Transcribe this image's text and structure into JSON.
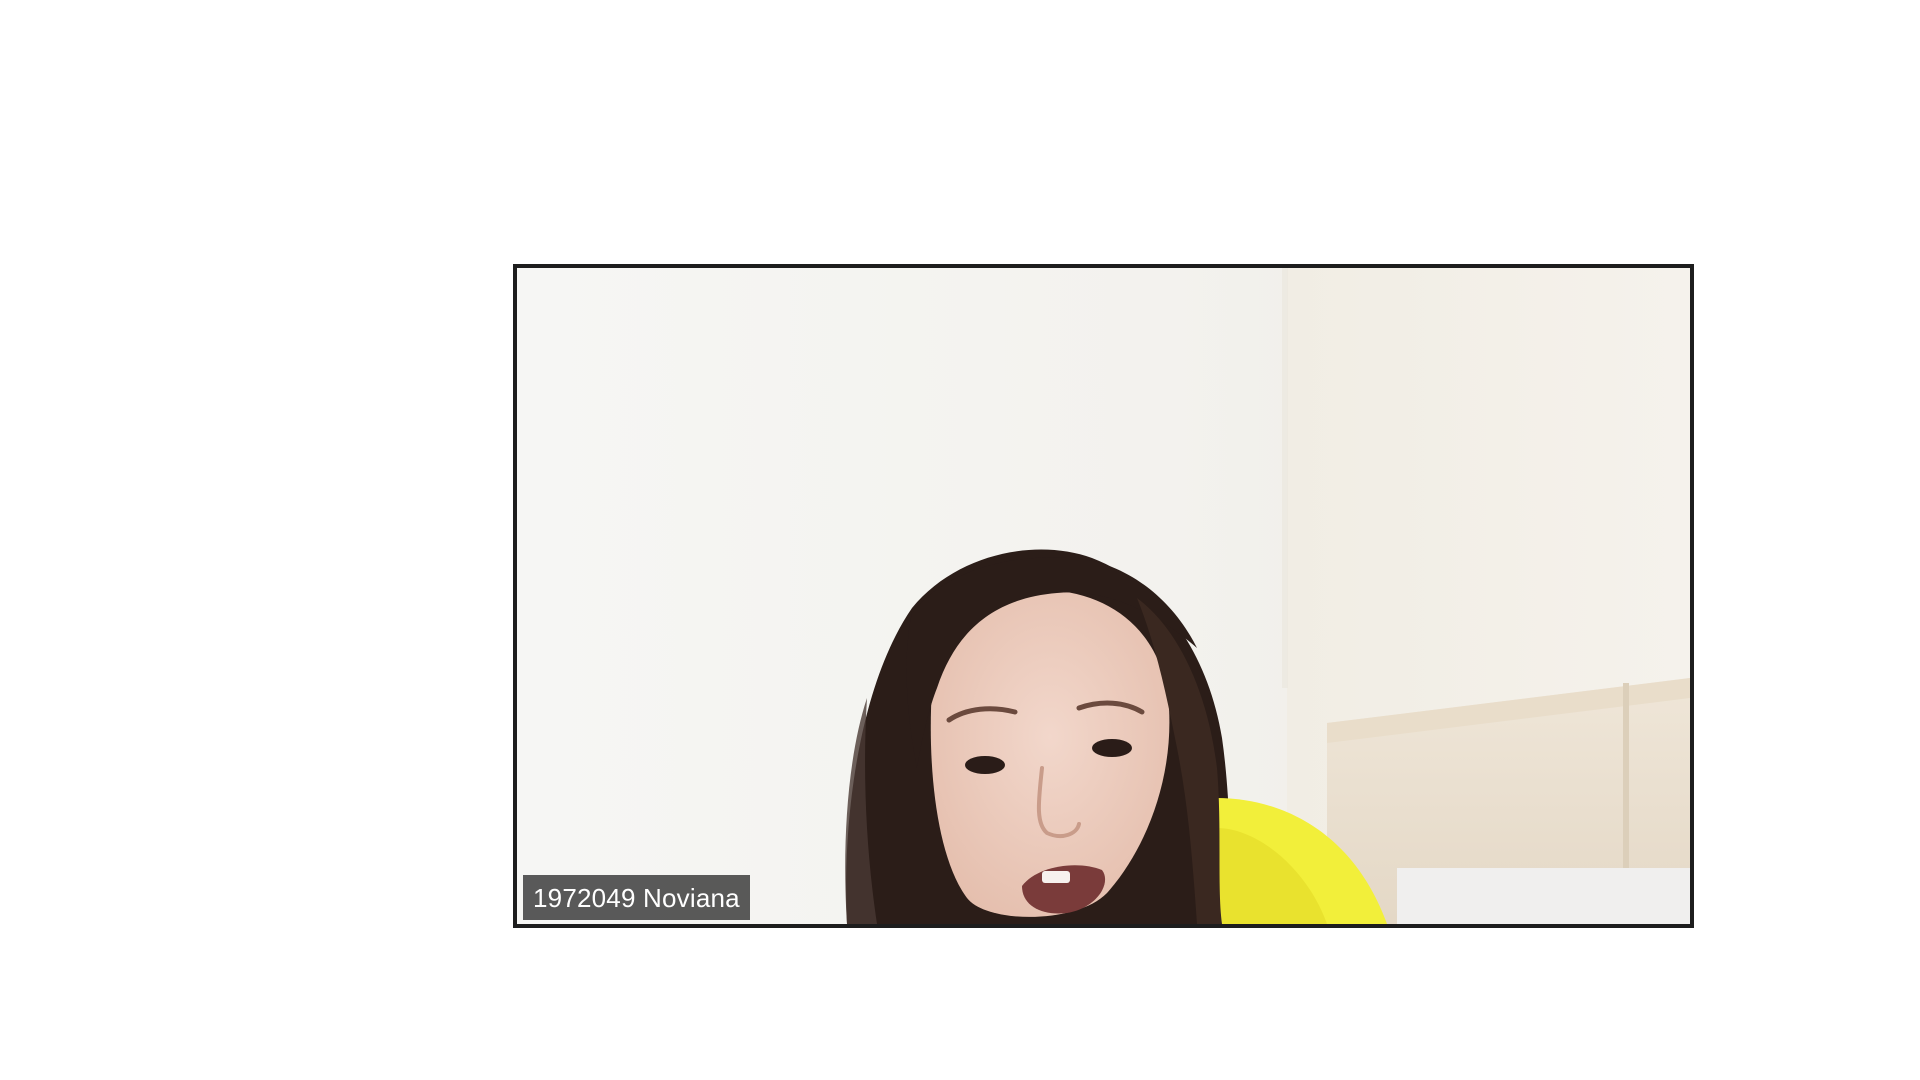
{
  "participant": {
    "name_label": "1972049 Noviana"
  },
  "colors": {
    "background": "#ffffff",
    "tile_border": "#1d1d1d",
    "name_tag_bg": "#2d2d2d",
    "name_tag_text": "#ffffff"
  },
  "icons": []
}
